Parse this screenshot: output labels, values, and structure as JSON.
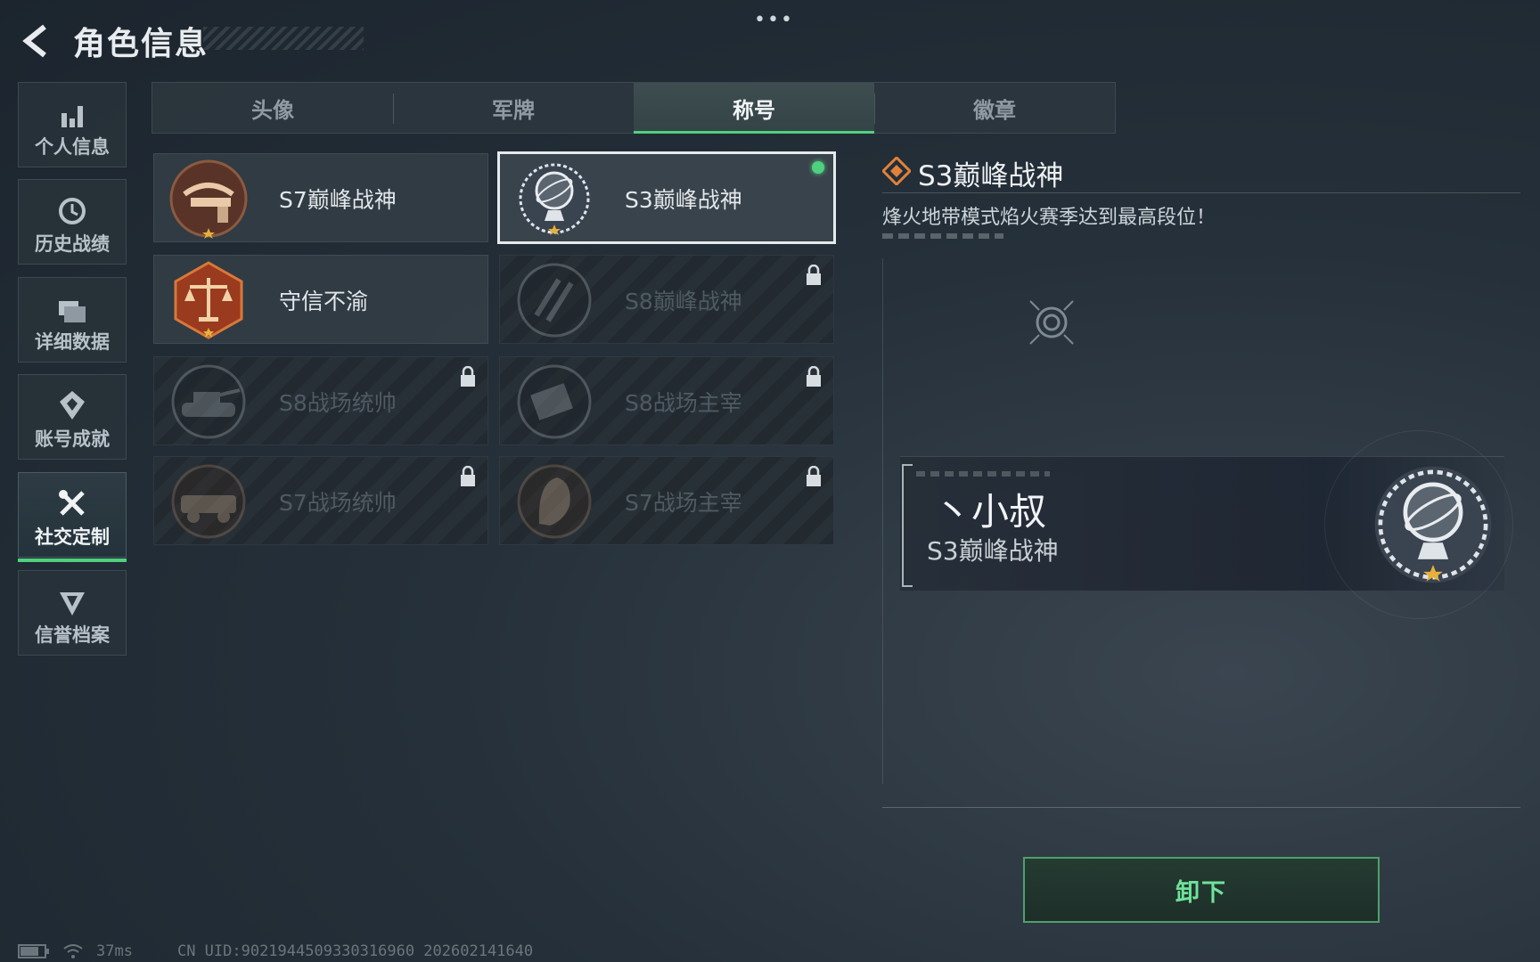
{
  "header": {
    "title": "角色信息"
  },
  "sidebar": {
    "items": [
      {
        "label": "个人信息",
        "icon": "bar-chart-icon"
      },
      {
        "label": "历史战绩",
        "icon": "history-clock-icon"
      },
      {
        "label": "详细数据",
        "icon": "folder-icon"
      },
      {
        "label": "账号成就",
        "icon": "medal-icon"
      },
      {
        "label": "社交定制",
        "icon": "tools-icon",
        "active": true
      },
      {
        "label": "信誉档案",
        "icon": "shield-badge-icon"
      }
    ]
  },
  "tabs": [
    {
      "label": "头像"
    },
    {
      "label": "军牌"
    },
    {
      "label": "称号",
      "active": true
    },
    {
      "label": "徽章"
    }
  ],
  "titles": [
    {
      "name": "S7巅峰战神",
      "locked": false,
      "emblem": "crossbow-emblem-icon"
    },
    {
      "name": "S3巅峰战神",
      "locked": false,
      "selected": true,
      "equipped": true,
      "emblem": "armillary-emblem-icon"
    },
    {
      "name": "守信不渝",
      "locked": false,
      "emblem": "scales-emblem-icon"
    },
    {
      "name": "S8巅峰战神",
      "locked": true,
      "emblem": "stripes-emblem-icon"
    },
    {
      "name": "S8战场统帅",
      "locked": true,
      "emblem": "tank-emblem-icon"
    },
    {
      "name": "S8战场主宰",
      "locked": true,
      "emblem": "rocket-emblem-icon"
    },
    {
      "name": "S7战场统帅",
      "locked": true,
      "emblem": "truck-emblem-icon"
    },
    {
      "name": "S7战场主宰",
      "locked": true,
      "emblem": "helmet-emblem-icon"
    }
  ],
  "detail": {
    "title": "S3巅峰战神",
    "description": "烽火地带模式焰火赛季达到最高段位！"
  },
  "nameplate": {
    "player_name": "丶小叔",
    "title": "S3巅峰战神"
  },
  "actions": {
    "unequip_label": "卸下"
  },
  "footer": {
    "ping": "37ms",
    "uid": "CN UID:9021944509330316960 202602141640"
  },
  "colors": {
    "accent": "#4fd07e",
    "detail_icon": "#e0823a"
  }
}
